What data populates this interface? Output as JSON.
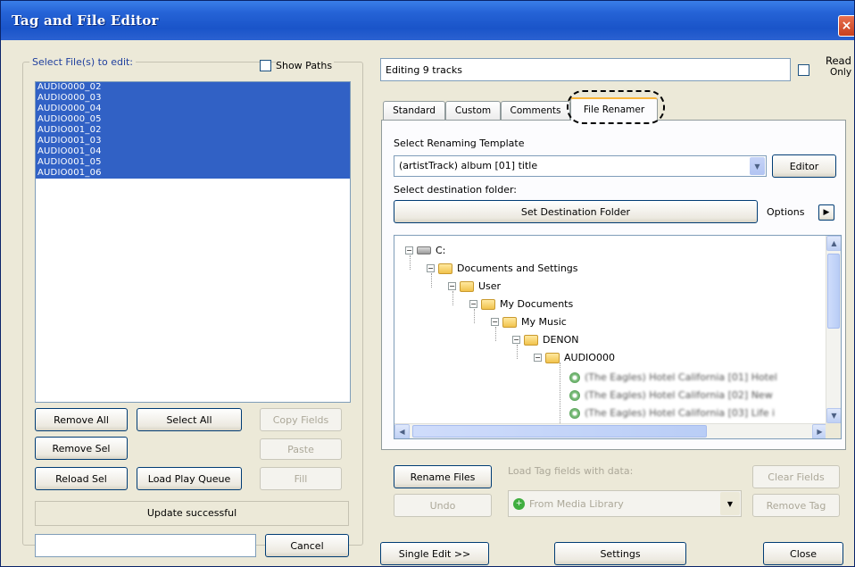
{
  "window": {
    "title": "Tag and File Editor"
  },
  "left_panel": {
    "group_label": "Select File(s) to edit:",
    "show_paths_label": "Show Paths",
    "files": [
      "AUDIO000_02",
      "AUDIO000_03",
      "AUDIO000_04",
      "AUDIO000_05",
      "AUDIO001_02",
      "AUDIO001_03",
      "AUDIO001_04",
      "AUDIO001_05",
      "AUDIO001_06"
    ],
    "buttons": {
      "remove_all": "Remove All",
      "select_all": "Select All",
      "copy_fields": "Copy Fields",
      "remove_sel": "Remove Sel",
      "paste": "Paste",
      "reload_sel": "Reload Sel",
      "load_play_queue": "Load Play Queue",
      "fill": "Fill",
      "cancel": "Cancel"
    },
    "status": "Update successful"
  },
  "right_panel": {
    "editing_text": "Editing 9 tracks",
    "read_only_label_1": "Read",
    "read_only_label_2": "Only",
    "tabs": [
      "Standard",
      "Custom",
      "Comments",
      "File Renamer"
    ],
    "active_tab": "File Renamer",
    "template_label": "Select Renaming Template",
    "template_value": "(artistTrack) album [01] title",
    "editor_button": "Editor",
    "destination_label": "Select destination folder:",
    "set_destination_button": "Set Destination Folder",
    "options_label": "Options",
    "tree": {
      "drive": "C:",
      "documents_and_settings": "Documents and Settings",
      "user": "User",
      "my_documents": "My Documents",
      "my_music": "My Music",
      "denon": "DENON",
      "audio000": "AUDIO000",
      "track_1": "(The Eagles) Hotel California [01] Hotel",
      "track_2": "(The Eagles) Hotel California [02] New",
      "track_3": "(The Eagles) Hotel California [03] Life i"
    },
    "rename_files_button": "Rename Files",
    "load_tag_label": "Load Tag fields with data:",
    "clear_fields_button": "Clear Fields",
    "undo_button": "Undo",
    "from_media_library": "From Media Library",
    "remove_tag_button": "Remove Tag",
    "single_edit_button": "Single Edit >>",
    "settings_button": "Settings",
    "close_button": "Close"
  }
}
